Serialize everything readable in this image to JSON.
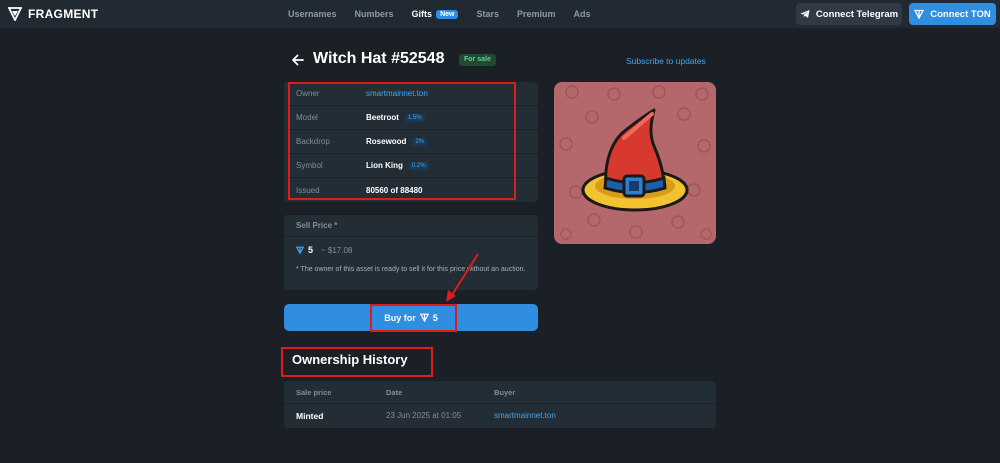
{
  "brand": {
    "name": "FRAGMENT"
  },
  "nav": {
    "items": [
      {
        "label": "Usernames",
        "active": false
      },
      {
        "label": "Numbers",
        "active": false
      },
      {
        "label": "Gifts",
        "active": true,
        "badge": "New"
      },
      {
        "label": "Stars",
        "active": false
      },
      {
        "label": "Premium",
        "active": false
      },
      {
        "label": "Ads",
        "active": false
      }
    ]
  },
  "header": {
    "connect_telegram": "Connect Telegram",
    "connect_ton": "Connect TON"
  },
  "item": {
    "title": "Witch Hat #52548",
    "status": "For sale",
    "subscribe": "Subscribe to updates",
    "owner_label": "Owner",
    "owner_value": "smartmainnet.ton",
    "model_label": "Model",
    "model_value": "Beetroot",
    "model_pct": "1.5%",
    "backdrop_label": "Backdrop",
    "backdrop_value": "Rosewood",
    "backdrop_pct": "2%",
    "symbol_label": "Symbol",
    "symbol_value": "Lion King",
    "symbol_pct": "0.2%",
    "issued_label": "Issued",
    "issued_value": "80560 of 88480"
  },
  "sell": {
    "heading": "Sell Price *",
    "price": "5",
    "usd": "~ $17.08",
    "note": "* The owner of this asset is ready to sell it for this price without an auction."
  },
  "buy": {
    "label": "Buy for",
    "amount": "5"
  },
  "history": {
    "title": "Ownership History",
    "col_price": "Sale price",
    "col_date": "Date",
    "col_buyer": "Buyer",
    "rows": [
      {
        "price": "Minted",
        "date": "23 Jun 2025 at 01:05",
        "buyer": "smartmainnet.ton"
      }
    ]
  },
  "colors": {
    "accent": "#2f8ee0",
    "highlight": "#e01b1b",
    "card_bg": "#b5686c"
  }
}
